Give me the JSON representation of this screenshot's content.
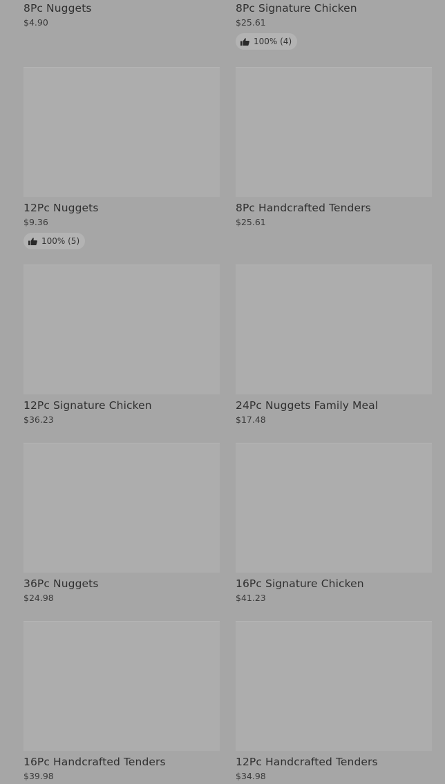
{
  "menu": {
    "items": [
      {
        "name": "8Pc Nuggets",
        "price": "$4.90"
      },
      {
        "name": "8Pc Signature Chicken",
        "price": "$25.61",
        "rating": "100% (4)"
      },
      {
        "name": "12Pc Nuggets",
        "price": "$9.36",
        "rating": "100% (5)"
      },
      {
        "name": "8Pc Handcrafted Tenders",
        "price": "$25.61"
      },
      {
        "name": "12Pc Signature Chicken",
        "price": "$36.23"
      },
      {
        "name": "24Pc Nuggets Family Meal",
        "price": "$17.48"
      },
      {
        "name": "36Pc Nuggets",
        "price": "$24.98"
      },
      {
        "name": "16Pc Signature Chicken",
        "price": "$41.23"
      },
      {
        "name": "16Pc Handcrafted Tenders",
        "price": "$39.98"
      },
      {
        "name": "12Pc Handcrafted Tenders",
        "price": "$34.98"
      }
    ]
  },
  "icons": {
    "rating": "thumbs-up-icon"
  }
}
